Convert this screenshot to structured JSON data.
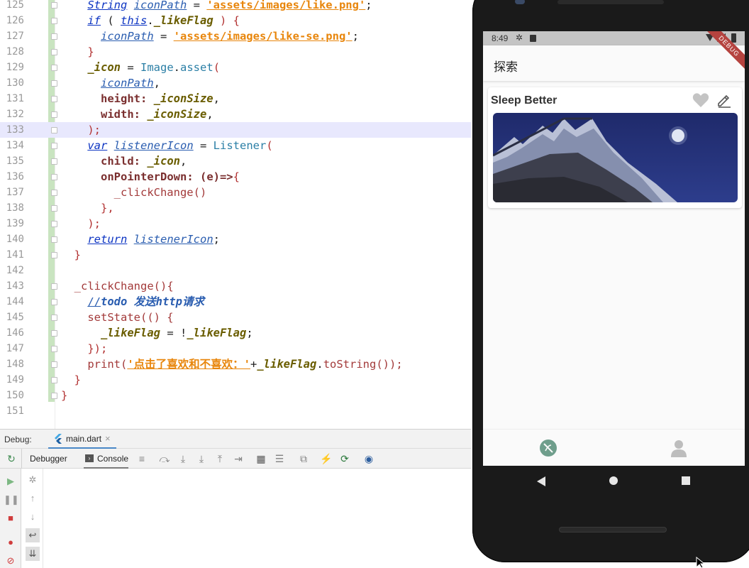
{
  "editor": {
    "lines": [
      {
        "n": "125",
        "parts": [
          [
            "    ",
            "plain"
          ],
          [
            "String",
            "kw"
          ],
          [
            " ",
            "plain"
          ],
          [
            "iconPath",
            "var"
          ],
          [
            " = ",
            "plain"
          ],
          [
            "'assets/images/like.png'",
            "str"
          ],
          [
            ";",
            "plain"
          ]
        ]
      },
      {
        "n": "126",
        "parts": [
          [
            "    ",
            "plain"
          ],
          [
            "if",
            "kw"
          ],
          [
            " ( ",
            "plain"
          ],
          [
            "this",
            "kw"
          ],
          [
            ".",
            "plain"
          ],
          [
            "_likeFlag",
            "fld"
          ],
          [
            " ) {",
            "punc"
          ]
        ]
      },
      {
        "n": "127",
        "parts": [
          [
            "      ",
            "plain"
          ],
          [
            "iconPath",
            "var"
          ],
          [
            " = ",
            "plain"
          ],
          [
            "'assets/images/like-se.png'",
            "str"
          ],
          [
            ";",
            "plain"
          ]
        ]
      },
      {
        "n": "128",
        "parts": [
          [
            "    ",
            "plain"
          ],
          [
            "}",
            "punc"
          ]
        ]
      },
      {
        "n": "129",
        "parts": [
          [
            "    ",
            "plain"
          ],
          [
            "_icon",
            "fld"
          ],
          [
            " = ",
            "plain"
          ],
          [
            "Image",
            "cls"
          ],
          [
            ".",
            "plain"
          ],
          [
            "asset",
            "cls"
          ],
          [
            "(",
            "punc"
          ]
        ]
      },
      {
        "n": "130",
        "parts": [
          [
            "      ",
            "plain"
          ],
          [
            "iconPath",
            "var"
          ],
          [
            ",",
            "plain"
          ]
        ]
      },
      {
        "n": "131",
        "parts": [
          [
            "      ",
            "plain"
          ],
          [
            "height: ",
            "prm"
          ],
          [
            "_iconSize",
            "fld"
          ],
          [
            ",",
            "plain"
          ]
        ]
      },
      {
        "n": "132",
        "parts": [
          [
            "      ",
            "plain"
          ],
          [
            "width: ",
            "prm"
          ],
          [
            "_iconSize",
            "fld"
          ],
          [
            ",",
            "plain"
          ]
        ]
      },
      {
        "n": "133",
        "parts": [
          [
            "    ",
            "plain"
          ],
          [
            ");",
            "punc"
          ]
        ]
      },
      {
        "n": "134",
        "parts": [
          [
            "    ",
            "plain"
          ],
          [
            "var",
            "kw"
          ],
          [
            " ",
            "plain"
          ],
          [
            "listenerIcon",
            "var"
          ],
          [
            " = ",
            "plain"
          ],
          [
            "Listener",
            "cls"
          ],
          [
            "(",
            "punc"
          ]
        ]
      },
      {
        "n": "135",
        "parts": [
          [
            "      ",
            "plain"
          ],
          [
            "child: ",
            "prm"
          ],
          [
            "_icon",
            "fld"
          ],
          [
            ",",
            "plain"
          ]
        ]
      },
      {
        "n": "136",
        "parts": [
          [
            "      ",
            "plain"
          ],
          [
            "onPointerDown: ",
            "prm"
          ],
          [
            "(e)=>",
            "prm"
          ],
          [
            "{",
            "punc"
          ]
        ]
      },
      {
        "n": "137",
        "parts": [
          [
            "        ",
            "plain"
          ],
          [
            "_clickChange()",
            "fn"
          ]
        ]
      },
      {
        "n": "138",
        "parts": [
          [
            "      ",
            "plain"
          ],
          [
            "},",
            "punc"
          ]
        ]
      },
      {
        "n": "139",
        "parts": [
          [
            "    ",
            "plain"
          ],
          [
            ");",
            "punc"
          ]
        ]
      },
      {
        "n": "140",
        "parts": [
          [
            "    ",
            "plain"
          ],
          [
            "return",
            "kw"
          ],
          [
            " ",
            "plain"
          ],
          [
            "listenerIcon",
            "var"
          ],
          [
            ";",
            "plain"
          ]
        ]
      },
      {
        "n": "141",
        "parts": [
          [
            "  ",
            "plain"
          ],
          [
            "}",
            "punc"
          ]
        ]
      },
      {
        "n": "142",
        "parts": []
      },
      {
        "n": "143",
        "parts": [
          [
            "  ",
            "plain"
          ],
          [
            "_clickChange(){",
            "fn"
          ]
        ]
      },
      {
        "n": "144",
        "parts": [
          [
            "    ",
            "plain"
          ],
          [
            "//",
            "cmt-u"
          ],
          [
            "todo 发送http请求",
            "cmt"
          ]
        ]
      },
      {
        "n": "145",
        "parts": [
          [
            "    ",
            "plain"
          ],
          [
            "setState(() {",
            "fn"
          ]
        ]
      },
      {
        "n": "146",
        "parts": [
          [
            "      ",
            "plain"
          ],
          [
            "_likeFlag",
            "fld"
          ],
          [
            " = !",
            "plain"
          ],
          [
            "_likeFlag",
            "fld"
          ],
          [
            ";",
            "plain"
          ]
        ]
      },
      {
        "n": "147",
        "parts": [
          [
            "    ",
            "plain"
          ],
          [
            "});",
            "punc"
          ]
        ]
      },
      {
        "n": "148",
        "parts": [
          [
            "    ",
            "plain"
          ],
          [
            "print(",
            "fn"
          ],
          [
            "'点击了喜欢和不喜欢：'",
            "str"
          ],
          [
            "+",
            "plain"
          ],
          [
            "_likeFlag",
            "fld"
          ],
          [
            ".",
            "plain"
          ],
          [
            "toString());",
            "fn"
          ]
        ]
      },
      {
        "n": "149",
        "parts": [
          [
            "  ",
            "plain"
          ],
          [
            "}",
            "punc"
          ]
        ]
      },
      {
        "n": "150",
        "parts": [
          [
            "",
            "plain"
          ],
          [
            "}",
            "punc"
          ]
        ]
      },
      {
        "n": "151",
        "parts": []
      }
    ],
    "current_line": "133"
  },
  "debug": {
    "label": "Debug:",
    "file_tab": "main.dart",
    "close_glyph": "×",
    "debugger_tab": "Debugger",
    "console_tab": "Console"
  },
  "phone": {
    "status_time": "8:49",
    "debug_banner": "DEBUG",
    "app_title": "探索",
    "card_title": "Sleep Better",
    "colors": {
      "nav_active": "#6f9e8c",
      "nav_inactive": "#bdbdbd",
      "ribbon": "#b5433f"
    }
  }
}
